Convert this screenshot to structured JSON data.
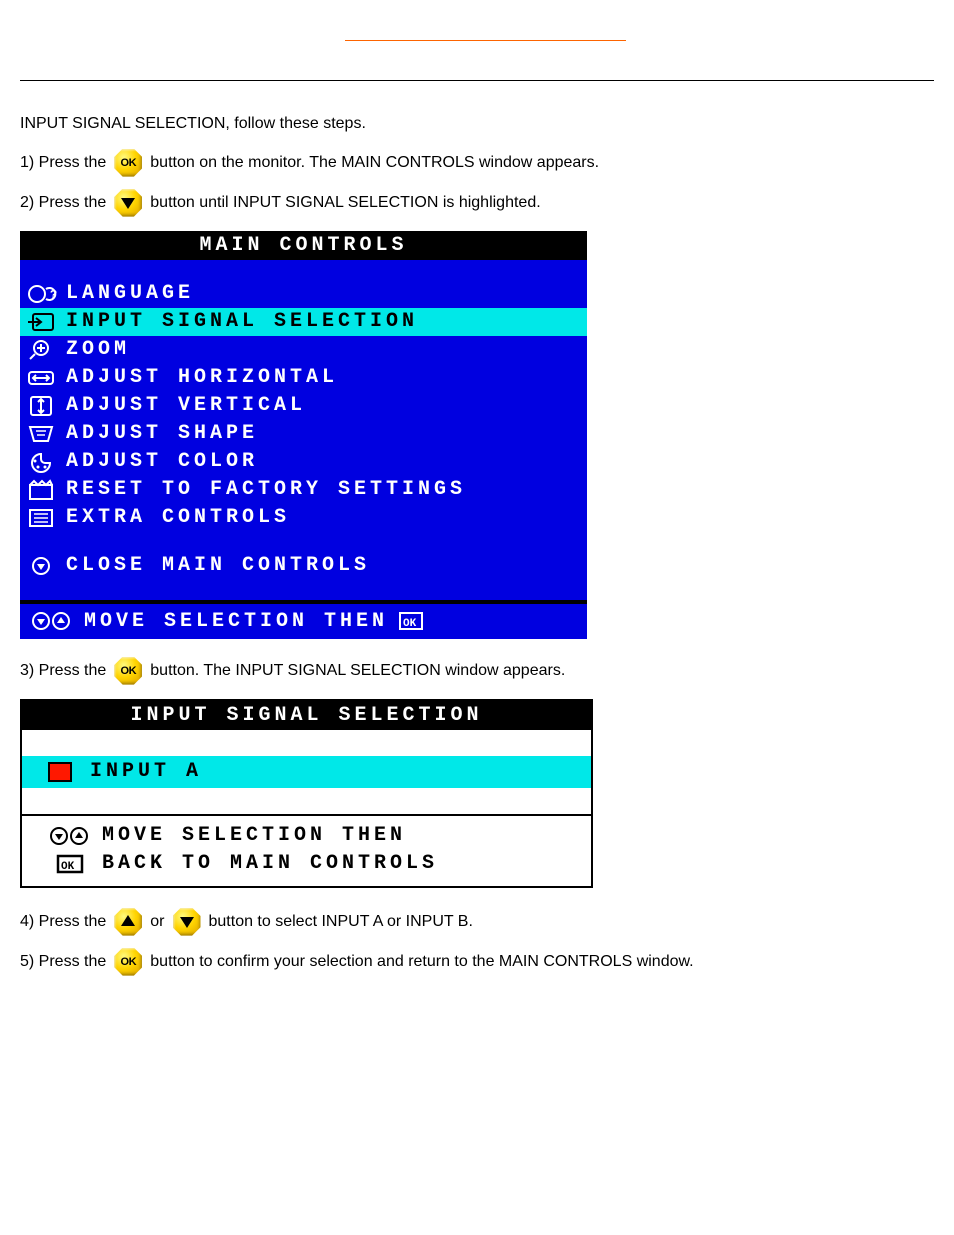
{
  "top_link": {
    "label": ""
  },
  "intro": {
    "line": "INPUT SIGNAL SELECTION, follow these steps."
  },
  "steps": {
    "s1_a": "1) Press the",
    "s1_b": "button on the monitor. The MAIN CONTROLS window appears.",
    "s2_a": "2) Press the",
    "s2_b": "button until INPUT SIGNAL SELECTION is highlighted.",
    "s3_a": "3) Press the",
    "s3_b": "button. The INPUT SIGNAL SELECTION window appears.",
    "s4_a": "4) Press the",
    "s4_or": "or",
    "s4_b": "button to select INPUT A or INPUT B.",
    "s5_a": "5) Press the",
    "s5_b": "button to confirm your selection and return to the MAIN CONTROLS window."
  },
  "osd": {
    "title": "MAIN CONTROLS",
    "items": [
      {
        "label": "LANGUAGE"
      },
      {
        "label": "INPUT SIGNAL SELECTION",
        "highlight": true
      },
      {
        "label": "ZOOM"
      },
      {
        "label": "ADJUST HORIZONTAL"
      },
      {
        "label": "ADJUST VERTICAL"
      },
      {
        "label": "ADJUST SHAPE"
      },
      {
        "label": "ADJUST COLOR"
      },
      {
        "label": "RESET TO FACTORY SETTINGS"
      },
      {
        "label": "EXTRA CONTROLS"
      }
    ],
    "close": "CLOSE MAIN CONTROLS",
    "footer": "MOVE SELECTION THEN"
  },
  "iss": {
    "title": "INPUT SIGNAL SELECTION",
    "option": "INPUT A",
    "footer1": "MOVE SELECTION THEN",
    "footer2": "BACK TO MAIN CONTROLS"
  }
}
